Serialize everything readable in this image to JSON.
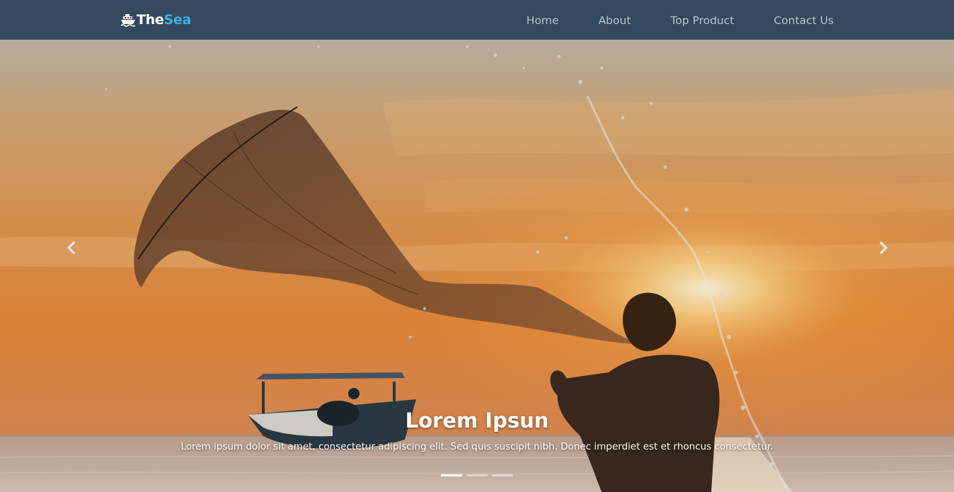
{
  "brand": {
    "part1": "The",
    "part2": "Sea",
    "icon": "ship-icon",
    "accent_color": "#3ab4e8"
  },
  "nav": {
    "items": [
      {
        "label": "Home"
      },
      {
        "label": "About"
      },
      {
        "label": "Top Product"
      },
      {
        "label": "Contact Us"
      }
    ]
  },
  "carousel": {
    "caption_title": "Lorem Ipsun",
    "caption_text": "Lorem ipsum dolor sit amet, consectetur adipiscing elit. Sed quis suscipit nibh. Donec imperdiet est et rhoncus consectetur.",
    "prev_icon": "chevron-left-icon",
    "next_icon": "chevron-right-icon",
    "slide_count": 3,
    "active_slide": 1
  },
  "colors": {
    "navbar_bg": "#34495e",
    "nav_text": "#b8c2cc"
  }
}
